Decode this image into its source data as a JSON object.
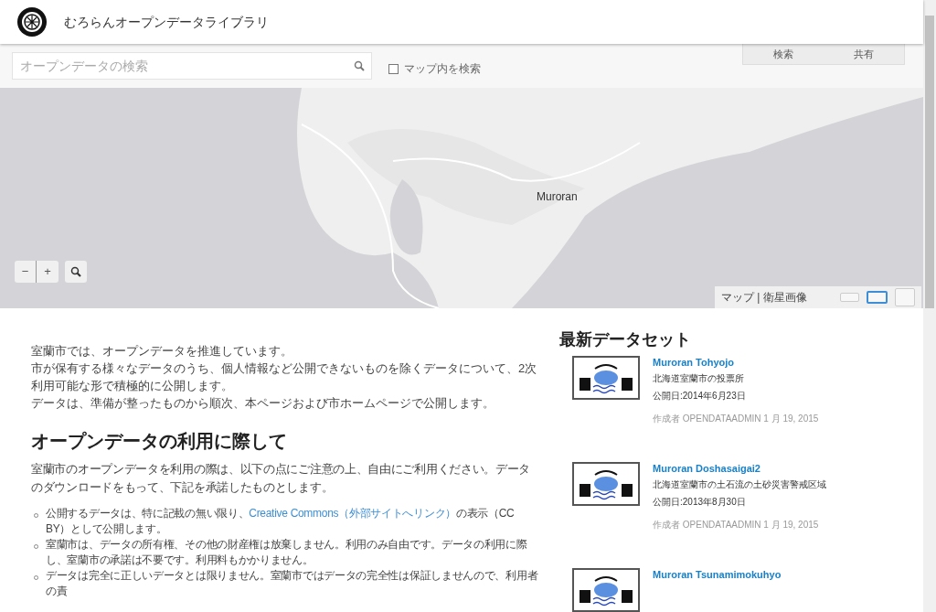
{
  "header": {
    "title": "むろらんオープンデータライブラリ"
  },
  "search": {
    "placeholder": "オープンデータの検索",
    "map_only": {
      "label": "マップ内を検索",
      "checked": false
    }
  },
  "tabs": [
    {
      "label": "検索",
      "selected": false
    },
    {
      "label": "共有",
      "selected": false
    }
  ],
  "map": {
    "place_label": "Muroran",
    "type_label": "マップ | 衛星画像",
    "zoom_out": "−",
    "zoom_in": "+",
    "styles": [
      {
        "selected": false
      },
      {
        "selected": true
      },
      {
        "selected": false
      }
    ]
  },
  "intro": [
    "室蘭市では、オープンデータを推進しています。",
    "市が保有する様々なデータのうち、個人情報など公開できないものを除くデータについて、2次利用可能な形で積極的に公開します。",
    "データは、準備が整ったものから順次、本ページおよび市ホームページで公開します。"
  ],
  "section": {
    "heading": "オープンデータの利用に際して",
    "lead": "室蘭市のオープンデータを利用の際は、以下の点にご注意の上、自由にご利用ください。データのダウンロードをもって、下記を承諾したものとします。",
    "bullets": [
      {
        "before": "公開するデータは、特に記載の無い限り、",
        "link": "Creative Commons（外部サイトへリンク）",
        "after": "の表示（CC BY）として公開します。"
      },
      {
        "before": "室蘭市は、データの所有権、その他の財産権は放棄しません。利用のみ自由です。データの利用に際し、室蘭市の承諾は不要です。利用料もかかりません。"
      },
      {
        "before": "データは完全に正しいデータとは限りません。室蘭市ではデータの完全性は保証しませんので、利用者の責"
      }
    ]
  },
  "latest": {
    "heading": "最新データセット",
    "datasets": [
      {
        "title": "Muroran Tohyojo",
        "description": "北海道室蘭市の投票所",
        "published": "公開日:2014年6月23日",
        "author": "作成者 OPENDATAADMIN 1 月 19, 2015"
      },
      {
        "title": "Muroran Doshasaigai2",
        "description": "北海道室蘭市の土石流の土砂災害警戒区域",
        "published": "公開日:2013年8月30日",
        "author": "作成者 OPENDATAADMIN 1 月 19, 2015"
      },
      {
        "title": "Muroran Tsunamimokuhyo"
      }
    ]
  }
}
